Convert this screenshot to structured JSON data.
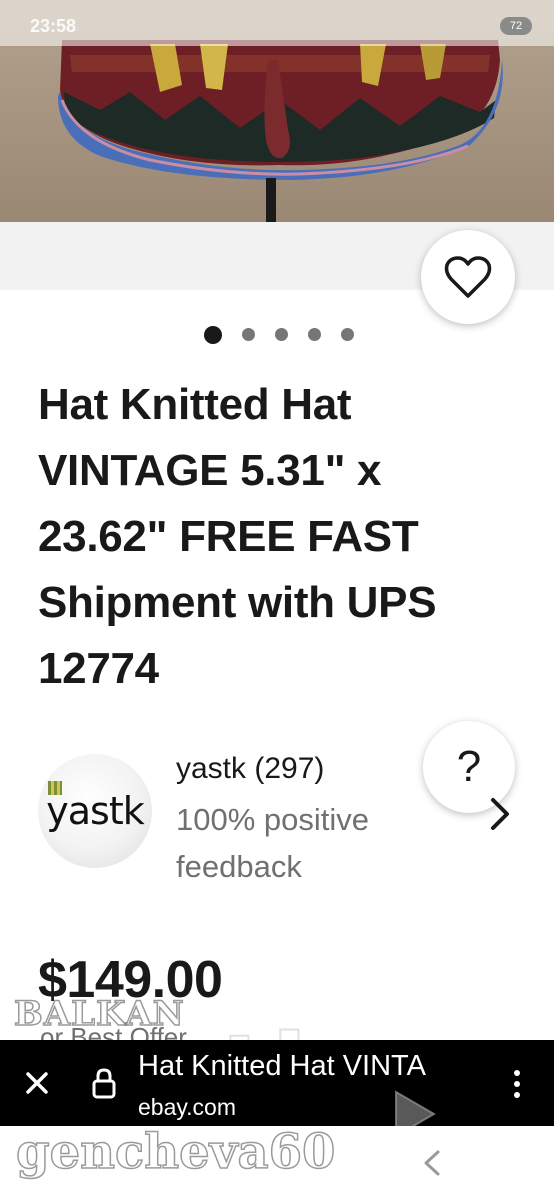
{
  "status_bar": {
    "time": "23:58",
    "battery": "72"
  },
  "product": {
    "image_alt": "Knitted hat",
    "image_count": 5,
    "image_index": 1,
    "title": "Hat Knitted Hat VINTAGE 5.31\" x 23.62\" FREE FAST Shipment with UPS 12774",
    "price": "$149.00",
    "best_offer": "or Best Offer"
  },
  "seller": {
    "avatar_text": "yastk",
    "name": "yastk (297)",
    "feedback": "100% positive feedback"
  },
  "icons": {
    "favorite": "heart-icon",
    "help": "?",
    "seller_link": "chevron-right-icon",
    "close": "close-icon",
    "lock": "lock-icon",
    "more": "more-vertical-icon",
    "back": "back-icon"
  },
  "browser": {
    "tab_title": "Hat Knitted Hat VINTA",
    "url": "ebay.com"
  },
  "watermark": {
    "brand": "BALKAN",
    "auction": "auction",
    "user": "gencheva60"
  },
  "colors": {
    "text": "#191919",
    "muted": "#707070",
    "browser_bar": "#000000"
  }
}
